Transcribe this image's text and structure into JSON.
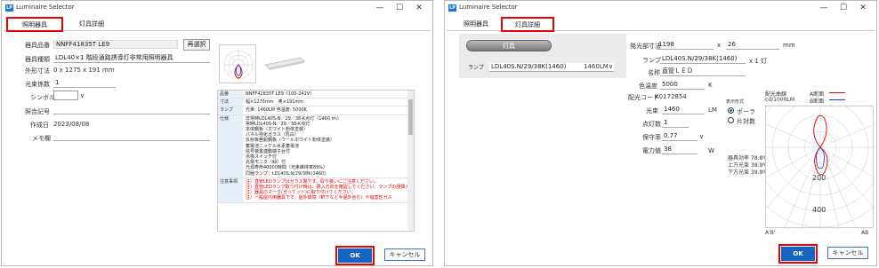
{
  "app_title": "Luminaire Selector",
  "logo_text": "LP",
  "window_controls": {
    "minimize": "—",
    "maximize": "☐",
    "close": "✕"
  },
  "tabs": {
    "basic": "照明器具",
    "detail": "灯具詳細"
  },
  "left": {
    "labels": {
      "product_no": "器具品番",
      "product_type": "器具種類",
      "dimensions": "外形寸法",
      "lamp_count": "光束係数",
      "symbol": "シンボル",
      "mark": "照合記号",
      "created": "作成日",
      "memo": "メモ欄"
    },
    "values": {
      "product_no": "NNFF41835T LE9",
      "product_type": "LDL40×1 階段通路誘導灯非常用照明器具",
      "dimensions": "0 x 1275 x 191 mm",
      "lamp_count": "1",
      "symbol_dropdown": "∨",
      "mark": "",
      "created": "2023/08/08",
      "memo": ""
    },
    "reselect_button": "再選択",
    "specs": [
      {
        "key": "品番",
        "val": "NNFF41835T LE9（100-242V）"
      },
      {
        "key": "寸法",
        "val": "幅×1275mm　奥×191mm"
      },
      {
        "key": "ランプ",
        "val": "光束: 1460LM 色温度: 5000K"
      },
      {
        "key": "仕様",
        "val": "非常時LDL40S-N／29／38-K点灯（1460 lm）\n常時LDL40S-N／29／38-K点灯\n本体鋼板（ホワイト粉体塗装）\nパネル強化ガラス（乳白）\n反射板亜鉛鋼板（ウールホワイト粉体塗装）\n蓄電池ニッケル水素蓄電池\n信号装置連動端子台付\n点検スイッチ付\n充電モニタ（緑）付\n光源寿命40000時間（光束維持率85%）\n同梱ランプ：LDL40S.N/29/38K(1460)"
      },
      {
        "key": "注意事項",
        "val": "注）直管LEDランプはガラス製です。取り扱いにご注意ください。\n注）直管LEDランプ取り付け時は、挿入方向を確認してください。ランプの誤挿入\n注）器具のマーク(ガッケット)に取り付けてください。\n注）一般屋内用器具です。屋外環境（軒下など半屋外含む）や塩害性ガス",
        "red": true
      }
    ],
    "ok": "OK",
    "cancel": "キャンセル"
  },
  "right": {
    "lamp_button": "灯具",
    "lamp_label": "ランプ",
    "lamp_value": "LDL40S.N/29/38K(1460)",
    "lamp_lm": "1460LM",
    "labels": {
      "emit_size": "発光部寸法",
      "lamp": "ランプ",
      "name": "名称",
      "color_temp": "色温度",
      "light_code": "配光コード",
      "flux": "光束",
      "count": "点灯数",
      "maint": "保守率",
      "power": "電力値"
    },
    "values": {
      "emit_w": "1198",
      "emit_x": "x",
      "emit_h": "26",
      "emit_unit": "mm",
      "lamp": "LDL40S.N/29/38K(1460)",
      "lamp_suffix": "x 1 灯",
      "name": "直管ＬＥＤ",
      "color_temp": "5000",
      "color_unit": "K",
      "light_code": "K0172854",
      "flux": "1460",
      "flux_unit": "LM",
      "count": "1",
      "maint": "0.77",
      "power": "38",
      "power_unit": "W"
    },
    "display_mode": {
      "title": "表示形式",
      "polar": "ポーラ",
      "side": "片対数"
    },
    "efficiency": {
      "total": "器具効率 78.8%",
      "up": "上方光束 38.9%",
      "down": "下方光束 39.9%"
    },
    "curve_legend": {
      "title": "配光曲線",
      "unit": "cd/1000LM",
      "a": "A断面",
      "b": "B断面"
    },
    "chart_labels": {
      "r200": "200",
      "r400": "400",
      "left": "A'B'",
      "right": "AB"
    },
    "ok": "OK",
    "cancel": "キャンセル"
  }
}
